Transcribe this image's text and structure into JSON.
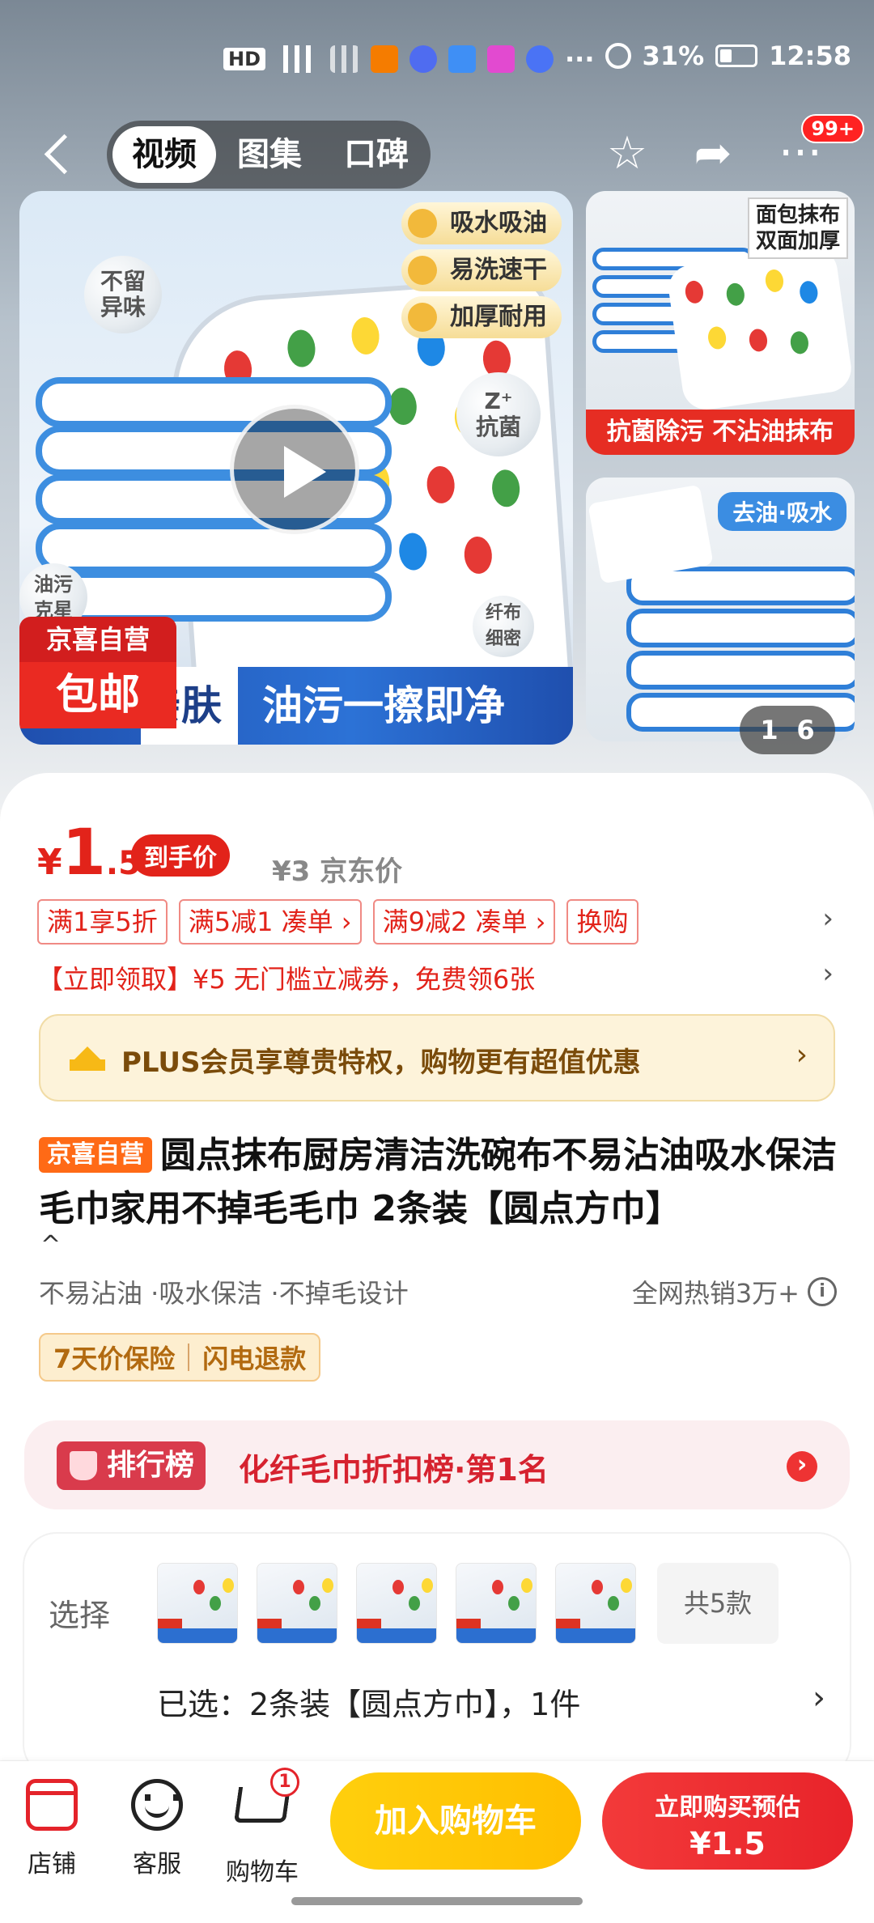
{
  "status_bar": {
    "network": "HD",
    "battery_percent": "31%",
    "time": "12:58",
    "more": "···"
  },
  "nav": {
    "tabs": [
      "视频",
      "图集",
      "口碑"
    ],
    "active_tab": 0,
    "message_badge": "99+"
  },
  "gallery": {
    "main": {
      "features": [
        "吸水吸油",
        "易洗速干",
        "加厚耐用"
      ],
      "bubbles": [
        "不留\n异味",
        "Z⁺\n抗菌",
        "油污\n克星",
        "纤布\n细密"
      ],
      "banner_left": "亲肤",
      "banner_right": "油污一擦即净",
      "tag_top": "京喜自营",
      "tag_bottom": "包邮"
    },
    "thumb_top": {
      "label": "面包抹布\n双面加厚",
      "caption": "抗菌除污 不沾油抹布"
    },
    "thumb_bottom": {
      "chip": "去油·吸水"
    },
    "counter_current": "1",
    "counter_total": "6"
  },
  "price": {
    "symbol": "¥",
    "integer": "1",
    "decimal": ".5",
    "tag": "到手价",
    "jd_price": "¥3 京东价"
  },
  "promos": [
    "满1享5折",
    "满5减1  凑单 ›",
    "满9减2  凑单 ›",
    "换购"
  ],
  "coupon": "【立即领取】¥5 无门槛立减券，免费领6张",
  "plus": {
    "text": "PLUS会员享尊贵特权，购物更有超值优惠",
    "chevron": "›"
  },
  "product": {
    "self_tag": "京喜自营",
    "title": "圆点抹布厨房清洁洗碗布不易沾油吸水保洁毛巾家用不掉毛毛巾 2条装【圆点方巾】",
    "features": "不易沾油 ·吸水保洁 ·不掉毛设计",
    "hot_sale": "全网热销3万+",
    "guarantees": [
      "7天价保险",
      "闪电退款"
    ]
  },
  "rank": {
    "label": "排行榜",
    "text": "化纤毛巾折扣榜·第1名"
  },
  "selection": {
    "label": "选择",
    "more": "共5款",
    "selected": "已选：2条装【圆点方巾】，1件"
  },
  "bottom_bar": {
    "store": "店铺",
    "service": "客服",
    "cart": "购物车",
    "cart_count": "1",
    "add_to_cart": "加入购物车",
    "buy_now_line1": "立即购买预估",
    "buy_now_line2": "¥1.5"
  },
  "colors": {
    "accent_red": "#e2231a",
    "cart_yellow": "#ffc400",
    "buy_red": "#ee2d2d",
    "self_orange": "#ff6a16"
  }
}
